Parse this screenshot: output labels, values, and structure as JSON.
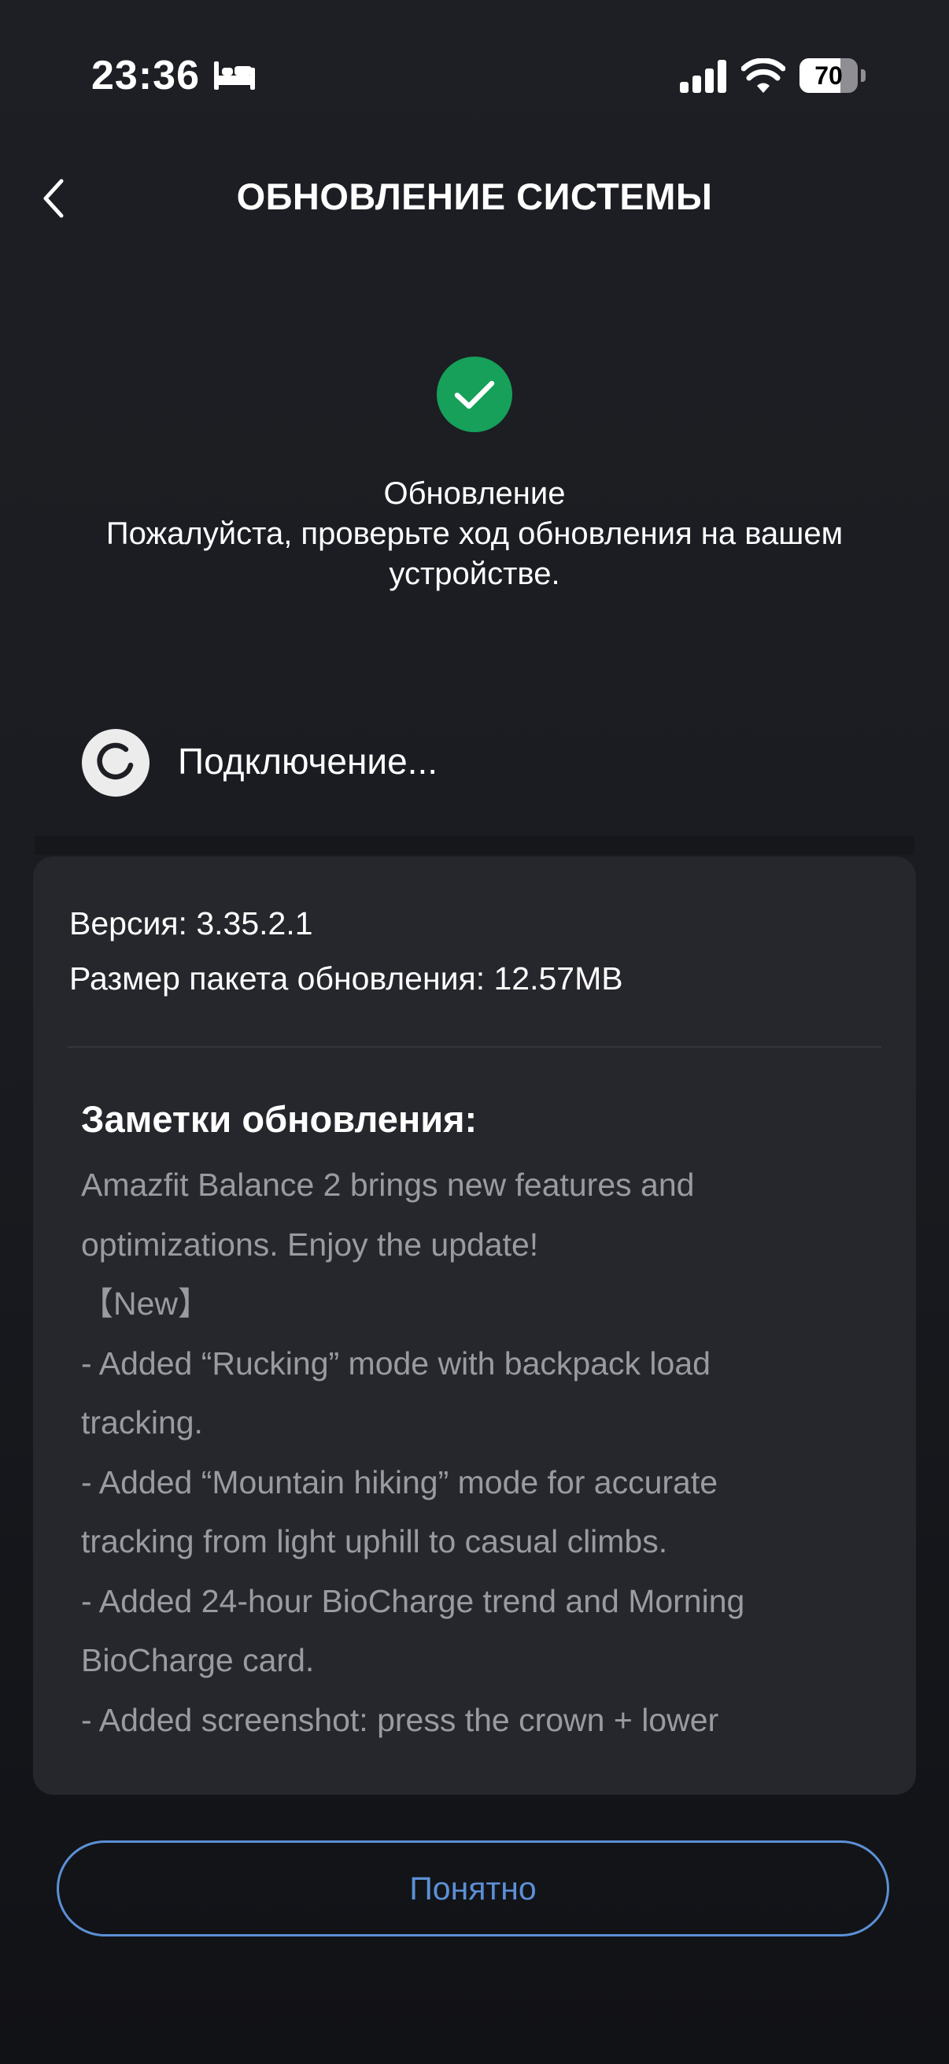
{
  "status_bar": {
    "time": "23:36",
    "battery_level": 70,
    "battery_text": "70",
    "icons": [
      "bed-icon",
      "signal-icon",
      "wifi-icon",
      "battery-icon"
    ]
  },
  "header": {
    "title": "ОБНОВЛЕНИЕ СИСТЕМЫ",
    "back_icon": "chevron-left-icon"
  },
  "status": {
    "icon": "check-icon",
    "icon_color": "#16a05a",
    "title": "Обновление",
    "message_line1": "Пожалуйста, проверьте ход обновления на вашем",
    "message_line2": "устройстве."
  },
  "connection": {
    "icon": "spinner-icon",
    "label": "Подключение..."
  },
  "info": {
    "version": "Версия: 3.35.2.1",
    "package_size": "Размер пакета обновления: 12.57MB"
  },
  "notes": {
    "title": "Заметки обновления:",
    "lines": [
      "Amazfit Balance 2 brings new features and",
      "optimizations. Enjoy the update!",
      "【New】",
      "- Added “Rucking” mode with backpack load",
      "tracking.",
      "- Added “Mountain hiking” mode for accurate",
      "tracking from light uphill to casual climbs.",
      "- Added 24-hour BioCharge trend and Morning",
      "BioCharge card.",
      "- Added screenshot: press the crown + lower"
    ]
  },
  "actions": {
    "ok_label": "Понятно",
    "accent_color": "#5c90d6"
  }
}
